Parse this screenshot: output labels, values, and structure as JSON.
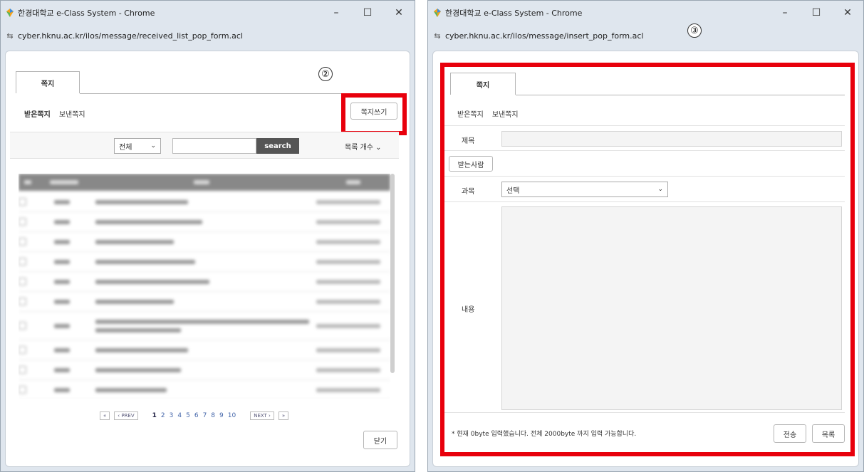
{
  "left_window": {
    "title": "한경대학교 e-Class System - Chrome",
    "url": "cyber.hknu.ac.kr/ilos/message/received_list_pop_form.acl",
    "controls": {
      "minimize": "–",
      "maximize": "☐",
      "close": "✕"
    },
    "tab_label": "쪽지",
    "subnav": [
      "받은쪽지",
      "보낸쪽지"
    ],
    "write_button": "쪽지쓰기",
    "annotation": "②",
    "filter_select": "전체",
    "search_button": "search",
    "list_count": "목록 개수",
    "pager": {
      "first": "«",
      "prev": "‹ PREV",
      "pages": [
        "1",
        "2",
        "3",
        "4",
        "5",
        "6",
        "7",
        "8",
        "9",
        "10"
      ],
      "next": "NEXT ›",
      "last": "»"
    },
    "close_button": "닫기"
  },
  "right_window": {
    "title": "한경대학교 e-Class System - Chrome",
    "url": "cyber.hknu.ac.kr/ilos/message/insert_pop_form.acl",
    "controls": {
      "minimize": "–",
      "maximize": "☐",
      "close": "✕"
    },
    "annotation": "③",
    "tab_label": "쪽지",
    "subnav": [
      "받은쪽지",
      "보낸쪽지"
    ],
    "subject_label": "제목",
    "recipient_button": "받는사람",
    "course_label": "과목",
    "course_select": "선택",
    "content_label": "내용",
    "note": "* 현재 0byte 입력했습니다. 전체 2000byte 까지 입력 가능합니다.",
    "send_button": "전송",
    "list_button": "목록"
  },
  "colors": {
    "highlight": "#e8000c",
    "search_button": "#555555"
  }
}
